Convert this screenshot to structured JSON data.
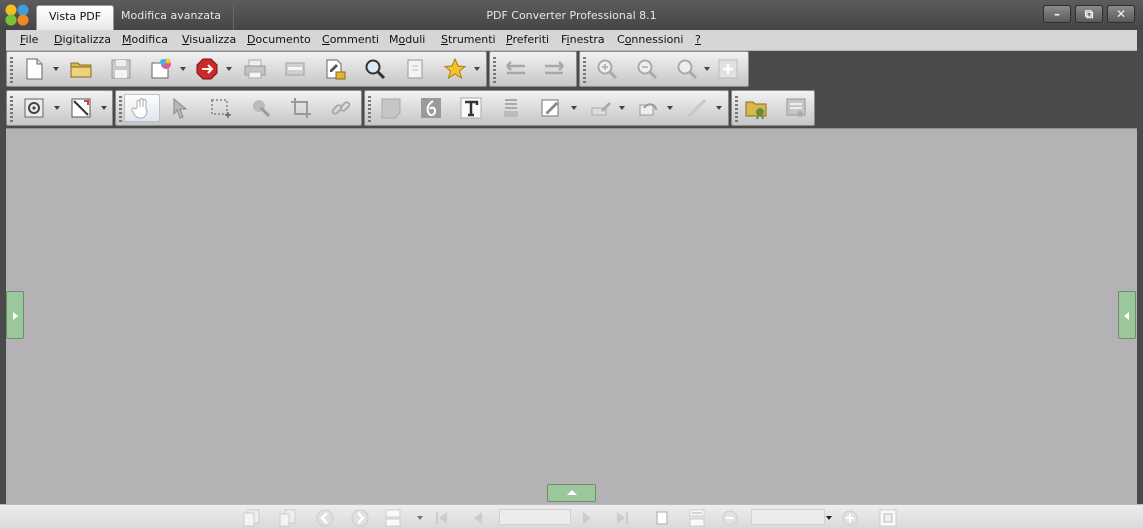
{
  "titlebar": {
    "app_title": "PDF Converter Professional 8.1",
    "tabs": [
      {
        "label": "Vista PDF",
        "active": true
      },
      {
        "label": "Modifica avanzata",
        "active": false
      }
    ],
    "window_controls": {
      "minimize": "–",
      "maximize": "⧉",
      "close": "✕"
    }
  },
  "menu": {
    "items": [
      {
        "label": "File",
        "underline": "F"
      },
      {
        "label": "Digitalizza",
        "underline": "D"
      },
      {
        "label": "Modifica",
        "underline": "M"
      },
      {
        "label": "Visualizza",
        "underline": "V"
      },
      {
        "label": "Documento",
        "underline": "D"
      },
      {
        "label": "Commenti",
        "underline": "C"
      },
      {
        "label": "Moduli",
        "underline": "o"
      },
      {
        "label": "Strumenti",
        "underline": "S"
      },
      {
        "label": "Preferiti",
        "underline": "P"
      },
      {
        "label": "Finestra",
        "underline": "i"
      },
      {
        "label": "Connessioni",
        "underline": "o"
      },
      {
        "label": "?",
        "underline": "?"
      }
    ]
  },
  "colors": {
    "accent_green": "#9cc79c",
    "document_background": "#b5b2b5",
    "chrome_dark": "#4a4a4a"
  },
  "toolbar_row1": {
    "icons": [
      "new-document-icon",
      "open-folder-icon",
      "save-icon",
      "create-pdf-icon",
      "convert-icon",
      "print-icon",
      "scan-icon",
      "secure-icon",
      "search-icon",
      "export-icon",
      "favorites-icon",
      "back-icon",
      "forward-icon",
      "zoom-in-icon",
      "zoom-out-icon",
      "zoom-tool-icon",
      "add-icon"
    ]
  },
  "toolbar_row2": {
    "icons": [
      "settings-icon",
      "ruler-icon",
      "hand-tool-icon",
      "select-tool-icon",
      "marquee-tool-icon",
      "snapshot-tool-icon",
      "crop-tool-icon",
      "link-tool-icon",
      "note-icon",
      "typewriter-icon",
      "text-tool-icon",
      "stamp-icon",
      "markup-icon",
      "highlight-icon",
      "shape-icon",
      "line-tool-icon",
      "certify-icon",
      "signature-icon"
    ]
  },
  "statusbar": {
    "page_field": "",
    "zoom_field": ""
  }
}
